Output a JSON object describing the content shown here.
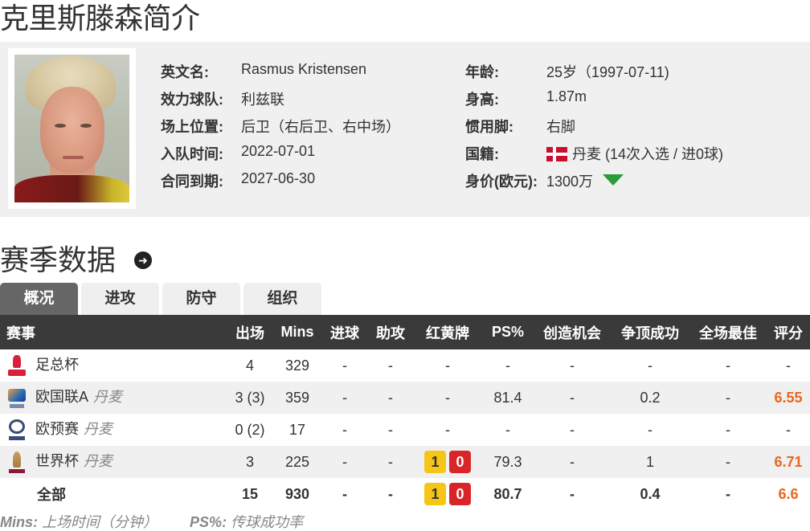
{
  "page": {
    "title": "克里斯滕森简介"
  },
  "profile": {
    "rows": [
      {
        "l_label": "英文名:",
        "l_value": "Rasmus Kristensen",
        "r_label": "年龄:",
        "r_value": "25岁（1997-07-11)"
      },
      {
        "l_label": "效力球队:",
        "l_value": "利兹联",
        "r_label": "身高:",
        "r_value": "1.87m"
      },
      {
        "l_label": "场上位置:",
        "l_value": "后卫（右后卫、右中场）",
        "r_label": "惯用脚:",
        "r_value": "右脚"
      },
      {
        "l_label": "入队时间:",
        "l_value": "2022-07-01",
        "r_label": "国籍:",
        "r_value": "丹麦 (14次入选 / 进0球)"
      },
      {
        "l_label": "合同到期:",
        "l_value": "2027-06-30",
        "r_label": "身价(欧元):",
        "r_value": "1300万"
      }
    ],
    "value_trend_icon": "arrow-down-icon",
    "trend_color": "#2a9a3a",
    "nationality_flag": "denmark-flag-icon"
  },
  "season": {
    "title": "赛季数据",
    "tabs": [
      "概况",
      "进攻",
      "防守",
      "组织"
    ],
    "active_tab": 0,
    "headers": [
      "赛事",
      "出场",
      "Mins",
      "进球",
      "助攻",
      "红黄牌",
      "PS%",
      "创造机会",
      "争顶成功",
      "全场最佳",
      "评分"
    ],
    "rows": [
      {
        "competition": "足总杯",
        "team": "",
        "icon": "fa-cup-icon",
        "apps": "4",
        "mins": "329",
        "goals": "-",
        "assists": "-",
        "cards": "-",
        "yellow": "",
        "red": "",
        "ps": "-",
        "chances": "-",
        "aerials": "-",
        "motm": "-",
        "rating": "-"
      },
      {
        "competition": "欧国联A",
        "team": "丹麦",
        "icon": "nations-league-icon",
        "apps": "3 (3)",
        "mins": "359",
        "goals": "-",
        "assists": "-",
        "cards": "-",
        "yellow": "",
        "red": "",
        "ps": "81.4",
        "chances": "-",
        "aerials": "0.2",
        "motm": "-",
        "rating": "6.55"
      },
      {
        "competition": "欧预赛",
        "team": "丹麦",
        "icon": "euro-qualifiers-icon",
        "apps": "0 (2)",
        "mins": "17",
        "goals": "-",
        "assists": "-",
        "cards": "-",
        "yellow": "",
        "red": "",
        "ps": "-",
        "chances": "-",
        "aerials": "-",
        "motm": "-",
        "rating": "-"
      },
      {
        "competition": "世界杯",
        "team": "丹麦",
        "icon": "world-cup-icon",
        "apps": "3",
        "mins": "225",
        "goals": "-",
        "assists": "-",
        "cards": "",
        "yellow": "1",
        "red": "0",
        "ps": "79.3",
        "chances": "-",
        "aerials": "1",
        "motm": "-",
        "rating": "6.71"
      }
    ],
    "total": {
      "competition": "全部",
      "apps": "15",
      "mins": "930",
      "goals": "-",
      "assists": "-",
      "yellow": "1",
      "red": "0",
      "ps": "80.7",
      "chances": "-",
      "aerials": "0.4",
      "motm": "-",
      "rating": "6.6"
    },
    "legend": {
      "mins_key": "Mins:",
      "mins_desc": "上场时间（分钟）",
      "ps_key": "PS%:",
      "ps_desc": "传球成功率"
    },
    "colors": {
      "rating": "#e8671e",
      "yellow_card": "#f5c518",
      "red_card": "#d9252a",
      "header_bg": "#3a3a3a",
      "active_tab_bg": "#666666"
    }
  }
}
